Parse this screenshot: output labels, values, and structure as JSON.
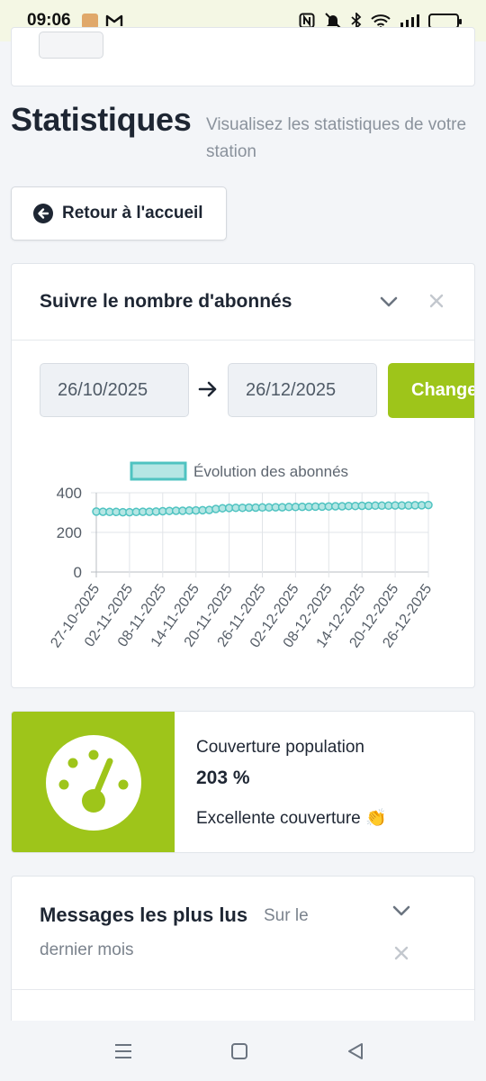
{
  "status_bar": {
    "time": "09:06",
    "icons": [
      "package-icon",
      "gmail-icon",
      "nfc-icon",
      "mute-icon",
      "bluetooth-icon",
      "wifi-icon",
      "signal-icon",
      "battery-icon"
    ]
  },
  "page": {
    "title": "Statistiques",
    "subtitle": "Visualisez les statistiques de votre station"
  },
  "home_button": {
    "label": "Retour à l'accueil",
    "icon": "arrow-left-circle-icon"
  },
  "subscribers_card": {
    "title": "Suivre le nombre d'abonnés",
    "date_from": "26/10/2025",
    "date_to": "26/12/2025",
    "change_label": "Changer"
  },
  "chart_data": {
    "type": "line",
    "legend": "Évolution des abonnés",
    "x_ticks": [
      "27-10-2025",
      "02-11-2025",
      "08-11-2025",
      "14-11-2025",
      "20-11-2025",
      "26-11-2025",
      "02-12-2025",
      "08-12-2025",
      "14-12-2025",
      "20-12-2025",
      "26-12-2025"
    ],
    "y_ticks": [
      "400",
      "200",
      "0"
    ],
    "ylim": [
      0,
      400
    ],
    "values": [
      305,
      304,
      303,
      303,
      302,
      302,
      303,
      304,
      304,
      305,
      307,
      308,
      309,
      309,
      310,
      311,
      312,
      313,
      318,
      322,
      323,
      324,
      324,
      325,
      325,
      326,
      326,
      327,
      327,
      328,
      328,
      329,
      329,
      330,
      330,
      331,
      332,
      332,
      333,
      333,
      334,
      334,
      335,
      335,
      335,
      336,
      336,
      336,
      337,
      337,
      338
    ],
    "colors": {
      "line": "#4fc3c1",
      "fill": "#b5e6e4"
    },
    "grid": true
  },
  "coverage": {
    "title": "Couverture population",
    "value": "203 %",
    "status": "Excellente couverture 👏",
    "accent": "#9ec51a"
  },
  "messages_card": {
    "title": "Messages les plus lus",
    "subtitle_a": "Sur le",
    "subtitle_b": "dernier mois"
  },
  "nav": {
    "icons": [
      "menu-icon",
      "home-square-icon",
      "back-triangle-icon"
    ]
  }
}
